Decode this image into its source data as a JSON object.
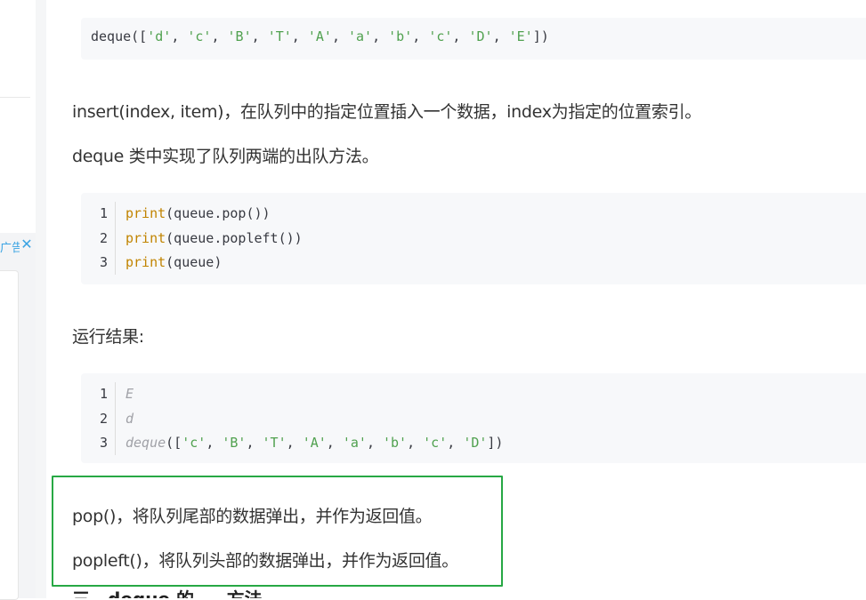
{
  "sidebar": {
    "ad_label": "广告",
    "close_icon": "close-icon"
  },
  "code_output_top": {
    "tokens": [
      {
        "t": "deque(["
      },
      {
        "t": "'d'",
        "c": "str"
      },
      {
        "t": ", "
      },
      {
        "t": "'c'",
        "c": "str"
      },
      {
        "t": ", "
      },
      {
        "t": "'B'",
        "c": "str"
      },
      {
        "t": ", "
      },
      {
        "t": "'T'",
        "c": "str"
      },
      {
        "t": ", "
      },
      {
        "t": "'A'",
        "c": "str"
      },
      {
        "t": ", "
      },
      {
        "t": "'a'",
        "c": "str"
      },
      {
        "t": ", "
      },
      {
        "t": "'b'",
        "c": "str"
      },
      {
        "t": ", "
      },
      {
        "t": "'c'",
        "c": "str"
      },
      {
        "t": ", "
      },
      {
        "t": "'D'",
        "c": "str"
      },
      {
        "t": ", "
      },
      {
        "t": "'E'",
        "c": "str"
      },
      {
        "t": "])"
      }
    ]
  },
  "para_insert": "insert(index, item)，在队列中的指定位置插入一个数据，index为指定的位置索引。",
  "para_deque": "deque 类中实现了队列两端的出队方法。",
  "code_pop": {
    "lines": [
      {
        "n": "1",
        "tokens": [
          {
            "t": "print",
            "c": "kw"
          },
          {
            "t": "(queue.pop())"
          }
        ]
      },
      {
        "n": "2",
        "tokens": [
          {
            "t": "print",
            "c": "kw"
          },
          {
            "t": "(queue.popleft())"
          }
        ]
      },
      {
        "n": "3",
        "tokens": [
          {
            "t": "print",
            "c": "kw"
          },
          {
            "t": "(queue)"
          }
        ]
      }
    ]
  },
  "para_result": "运行结果:",
  "code_result": {
    "lines": [
      {
        "n": "1",
        "tokens": [
          {
            "t": "E",
            "c": "it"
          }
        ]
      },
      {
        "n": "2",
        "tokens": [
          {
            "t": "d",
            "c": "it"
          }
        ]
      },
      {
        "n": "3",
        "tokens": [
          {
            "t": "deque",
            "c": "it"
          },
          {
            "t": "(["
          },
          {
            "t": "'c'",
            "c": "str"
          },
          {
            "t": ", "
          },
          {
            "t": "'B'",
            "c": "str"
          },
          {
            "t": ", "
          },
          {
            "t": "'T'",
            "c": "str"
          },
          {
            "t": ", "
          },
          {
            "t": "'A'",
            "c": "str"
          },
          {
            "t": ", "
          },
          {
            "t": "'a'",
            "c": "str"
          },
          {
            "t": ", "
          },
          {
            "t": "'b'",
            "c": "str"
          },
          {
            "t": ", "
          },
          {
            "t": "'c'",
            "c": "str"
          },
          {
            "t": ", "
          },
          {
            "t": "'D'",
            "c": "str"
          },
          {
            "t": "])"
          }
        ]
      }
    ]
  },
  "para_pop": "pop()，将队列尾部的数据弹出，并作为返回值。",
  "para_popleft": "popleft()，将队列头部的数据弹出，并作为返回值。",
  "next_heading": "三、deque 的 ... 方法",
  "colors": {
    "highlight_border": "#27a844",
    "keyword": "#c18401",
    "string": "#50a14f",
    "comment": "#a0a1a7"
  }
}
